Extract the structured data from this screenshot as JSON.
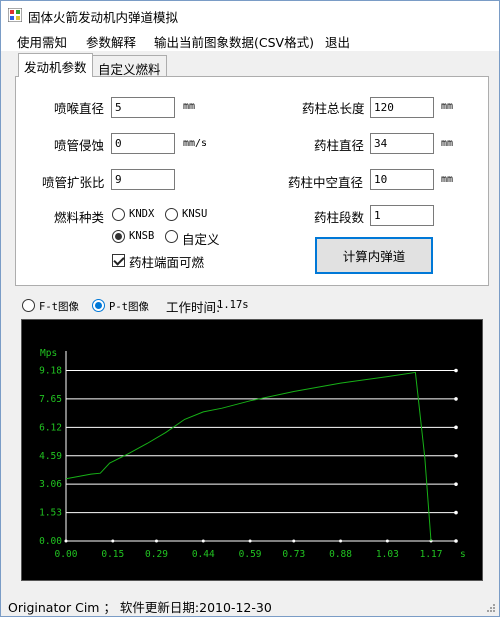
{
  "window": {
    "title": "固体火箭发动机内弹道模拟"
  },
  "menu": {
    "items": [
      "使用需知",
      "参数解释",
      "输出当前图象数据(CSV格式)",
      "退出"
    ]
  },
  "tabs": [
    "发动机参数",
    "自定义燃料"
  ],
  "params": {
    "throat_label": "喷喉直径",
    "throat_value": "5",
    "throat_unit": "mm",
    "erosion_label": "喷管侵蚀",
    "erosion_value": "0",
    "erosion_unit": "mm/s",
    "expansion_label": "喷管扩张比",
    "expansion_value": "9",
    "grain_length_label": "药柱总长度",
    "grain_length_value": "120",
    "grain_length_unit": "mm",
    "grain_diam_label": "药柱直径",
    "grain_diam_value": "34",
    "grain_diam_unit": "mm",
    "core_diam_label": "药柱中空直径",
    "core_diam_value": "10",
    "core_diam_unit": "mm",
    "segments_label": "药柱段数",
    "segments_value": "1",
    "fuel_label": "燃料种类",
    "fuel_options": [
      "KNDX",
      "KNSU",
      "KNSB",
      "自定义"
    ],
    "fuel_selected": "KNSB",
    "end_burn_label": "药柱端面可燃",
    "end_burn_checked": true,
    "compute_button": "计算内弹道"
  },
  "plot_mode": {
    "options": [
      "F-t图像",
      "P-t图像"
    ],
    "selected": "P-t图像",
    "work_time_label": "工作时间:",
    "work_time_value": "1.17s"
  },
  "chart_data": {
    "type": "line",
    "ylabel": "Mps",
    "xlabel": "s",
    "xlim": [
      0,
      1.25
    ],
    "ylim": [
      0,
      9.8
    ],
    "x_ticks": [
      "0.00",
      "0.15",
      "0.29",
      "0.44",
      "0.59",
      "0.73",
      "0.88",
      "1.03",
      "1.17"
    ],
    "y_ticks": [
      "0.00",
      "1.53",
      "3.06",
      "4.59",
      "6.12",
      "7.65",
      "9.18"
    ],
    "grid": true,
    "series": [
      {
        "color": "#17b117",
        "x": [
          0.0,
          0.08,
          0.11,
          0.14,
          0.2,
          0.26,
          0.32,
          0.38,
          0.44,
          0.5,
          0.59,
          0.73,
          0.88,
          1.03,
          1.12,
          1.15,
          1.17
        ],
        "y": [
          3.35,
          3.6,
          3.65,
          4.2,
          4.7,
          5.25,
          5.85,
          6.55,
          6.95,
          7.15,
          7.55,
          8.05,
          8.5,
          8.85,
          9.08,
          4.5,
          0.0
        ]
      }
    ],
    "axis_color": "#ffffff",
    "tick_label_color": "#21c321"
  },
  "status": {
    "text": "Originator Cim ； 软件更新日期:2010-12-30"
  }
}
